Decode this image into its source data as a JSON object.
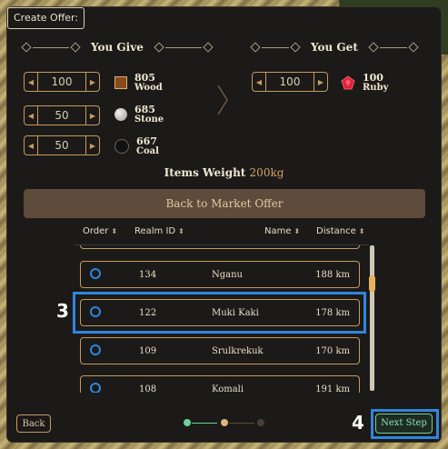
{
  "window_title": "Create Offer:",
  "give": {
    "header": "You Give",
    "items": [
      {
        "qty": "100",
        "amount": "805",
        "name": "Wood",
        "icon": "wood-icon"
      },
      {
        "qty": "50",
        "amount": "685",
        "name": "Stone",
        "icon": "stone-icon"
      },
      {
        "qty": "50",
        "amount": "667",
        "name": "Coal",
        "icon": "coal-icon"
      }
    ]
  },
  "get": {
    "header": "You Get",
    "qty": "100",
    "amount": "100",
    "name": "Ruby",
    "icon": "ruby-icon"
  },
  "weight": {
    "label": "Items Weight",
    "value": "200kg"
  },
  "back_market_label": "Back to Market Offer",
  "table": {
    "headers": {
      "order": "Order",
      "realm_id": "Realm ID",
      "name": "Name",
      "distance": "Distance"
    },
    "rows": [
      {
        "id": "134",
        "name": "Nganu",
        "distance": "188 km"
      },
      {
        "id": "122",
        "name": "Muki Kaki",
        "distance": "178 km"
      },
      {
        "id": "109",
        "name": "Srulkrekuk",
        "distance": "170 km"
      },
      {
        "id": "108",
        "name": "Komali",
        "distance": "191 km"
      }
    ]
  },
  "callouts": {
    "three": "3",
    "four": "4"
  },
  "footer": {
    "back_label": "Back",
    "next_label": "Next Step"
  },
  "colors": {
    "accent_gold": "#c79a5e",
    "highlight_blue": "#2e86e0",
    "step_green": "#6fd19a"
  },
  "steps": {
    "current": 2,
    "total": 3
  }
}
